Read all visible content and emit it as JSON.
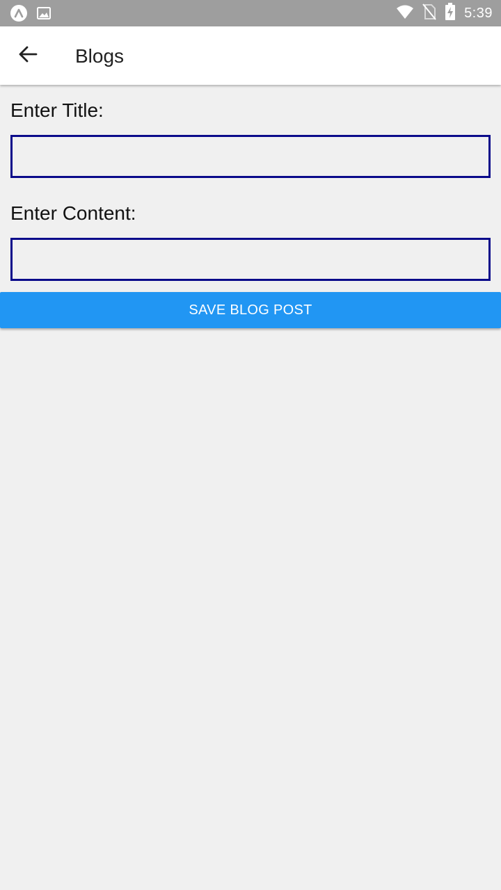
{
  "status_bar": {
    "time": "5:39",
    "left_icons": [
      "expo-icon",
      "image-icon"
    ],
    "right_icons": [
      "wifi-icon",
      "no-sim-icon",
      "battery-charging-icon"
    ],
    "background_color": "#9e9e9e"
  },
  "app_bar": {
    "title": "Blogs",
    "back_icon": "arrow-left-icon"
  },
  "form": {
    "title_label": "Enter Title:",
    "title_value": "",
    "content_label": "Enter Content:",
    "content_value": "",
    "input_border_color": "#0a0a8a"
  },
  "actions": {
    "save_label": "SAVE BLOG POST",
    "save_color": "#2196f3"
  }
}
